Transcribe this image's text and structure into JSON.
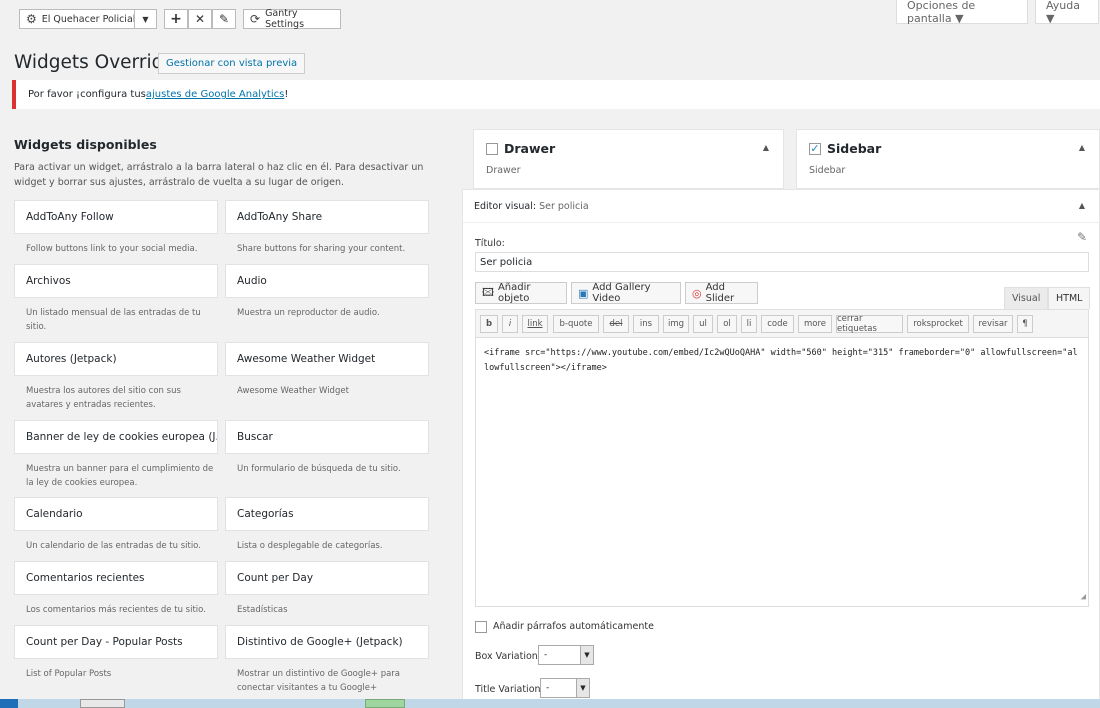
{
  "toolbar": {
    "site_name": "El Quehacer Policial",
    "gantry_settings": "Gantry Settings",
    "screen_options": "Opciones de pantalla ▼",
    "help": "Ayuda ▼"
  },
  "page": {
    "title": "Widgets Override",
    "preview_button": "Gestionar con vista previa"
  },
  "notice": {
    "prefix": "Por favor ¡configura tus ",
    "link": "ajustes de Google Analytics",
    "suffix": "!"
  },
  "available": {
    "title": "Widgets disponibles",
    "description": "Para activar un widget, arrástralo a la barra lateral o haz clic en él. Para desactivar un widget y borrar sus ajustes, arrástralo de vuelta a su lugar de origen.",
    "widgets": [
      {
        "name": "AddToAny Follow",
        "desc": "Follow buttons link to your social media."
      },
      {
        "name": "AddToAny Share",
        "desc": "Share buttons for sharing your content."
      },
      {
        "name": "Archivos",
        "desc": "Un listado mensual de las entradas de tu sitio."
      },
      {
        "name": "Audio",
        "desc": "Muestra un reproductor de audio."
      },
      {
        "name": "Autores (Jetpack)",
        "desc": "Muestra los autores del sitio con sus avatares y entradas recientes."
      },
      {
        "name": "Awesome Weather Widget",
        "desc": "Awesome Weather Widget"
      },
      {
        "name": "Banner de ley de cookies europea (J...",
        "desc": "Muestra un banner para el cumplimiento de la ley de cookies europea."
      },
      {
        "name": "Buscar",
        "desc": "Un formulario de búsqueda de tu sitio."
      },
      {
        "name": "Calendario",
        "desc": "Un calendario de las entradas de tu sitio."
      },
      {
        "name": "Categorías",
        "desc": "Lista o desplegable de categorías."
      },
      {
        "name": "Comentarios recientes",
        "desc": "Los comentarios más recientes de tu sitio."
      },
      {
        "name": "Count per Day",
        "desc": "Estadísticas"
      },
      {
        "name": "Count per Day - Popular Posts",
        "desc": "List of Popular Posts"
      },
      {
        "name": "Distintivo de Google+ (Jetpack)",
        "desc": "Mostrar un distintivo de Google+ para conectar visitantes a tu Google+"
      }
    ]
  },
  "areas": {
    "drawer": {
      "name": "Drawer",
      "sub": "Drawer"
    },
    "sidebar": {
      "name": "Sidebar",
      "sub": "Sidebar"
    }
  },
  "editor": {
    "header_label": "Editor visual:",
    "header_value": "Ser policia",
    "title_label": "Título:",
    "title_value": "Ser policia",
    "add_media": "Añadir objeto",
    "add_gallery": "Add Gallery Video",
    "add_slider": "Add Slider",
    "tab_visual": "Visual",
    "tab_html": "HTML",
    "quicktags": [
      "b",
      "i",
      "link",
      "b-quote",
      "del",
      "ins",
      "img",
      "ul",
      "ol",
      "li",
      "code",
      "more",
      "cerrar etiquetas",
      "roksprocket",
      "revisar",
      "¶"
    ],
    "content": "<iframe src=\"https://www.youtube.com/embed/Ic2wQUoQAHA\" width=\"560\" height=\"315\" frameborder=\"0\" allowfullscreen=\"allowfullscreen\"></iframe>",
    "auto_paragraphs": "Añadir párrafos automáticamente",
    "box_variation_label": "Box Variation",
    "box_variation_value": "-",
    "title_variation_label": "Title Variation",
    "title_variation_value": "-"
  }
}
